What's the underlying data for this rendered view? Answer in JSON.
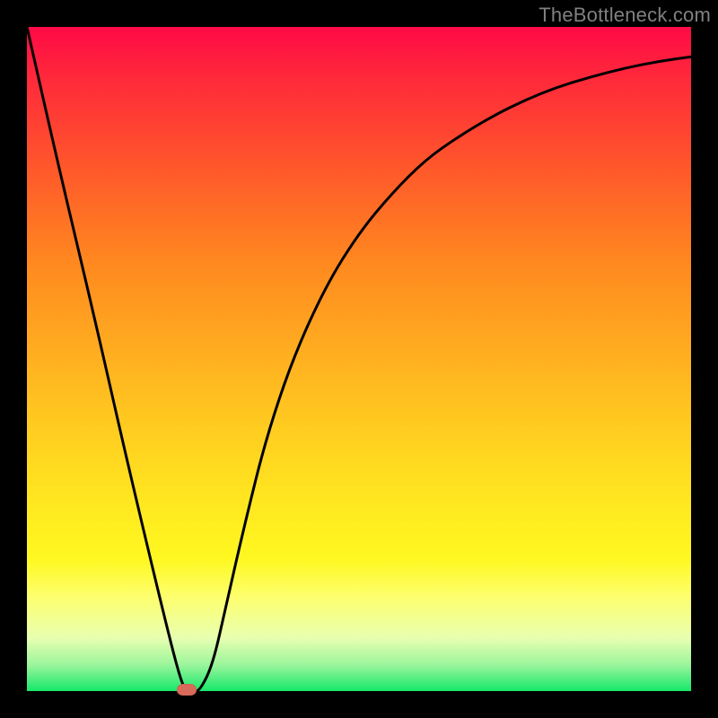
{
  "watermark": "TheBottleneck.com",
  "chart_data": {
    "type": "line",
    "title": "",
    "xlabel": "",
    "ylabel": "",
    "xlim": [
      0,
      100
    ],
    "ylim": [
      0,
      100
    ],
    "grid": false,
    "legend": false,
    "background_gradient": {
      "top": "#ff0a46",
      "bottom": "#16e86a",
      "meaning": "red = high bottleneck, green = low bottleneck"
    },
    "series": [
      {
        "name": "bottleneck-curve",
        "x": [
          0,
          5,
          10,
          15,
          20,
          23,
          24,
          25,
          26,
          28,
          30,
          33,
          36,
          40,
          45,
          50,
          55,
          60,
          65,
          70,
          75,
          80,
          85,
          90,
          95,
          100
        ],
        "values": [
          100,
          78,
          57,
          35,
          14,
          2,
          0,
          0,
          0,
          4,
          13,
          26,
          38,
          50,
          61,
          69,
          75,
          80,
          83.5,
          86.5,
          89,
          91,
          92.5,
          93.8,
          94.8,
          95.5
        ]
      }
    ],
    "marker": {
      "name": "optimal-point",
      "x": 24,
      "y": 0,
      "color": "#d86a5a"
    }
  }
}
